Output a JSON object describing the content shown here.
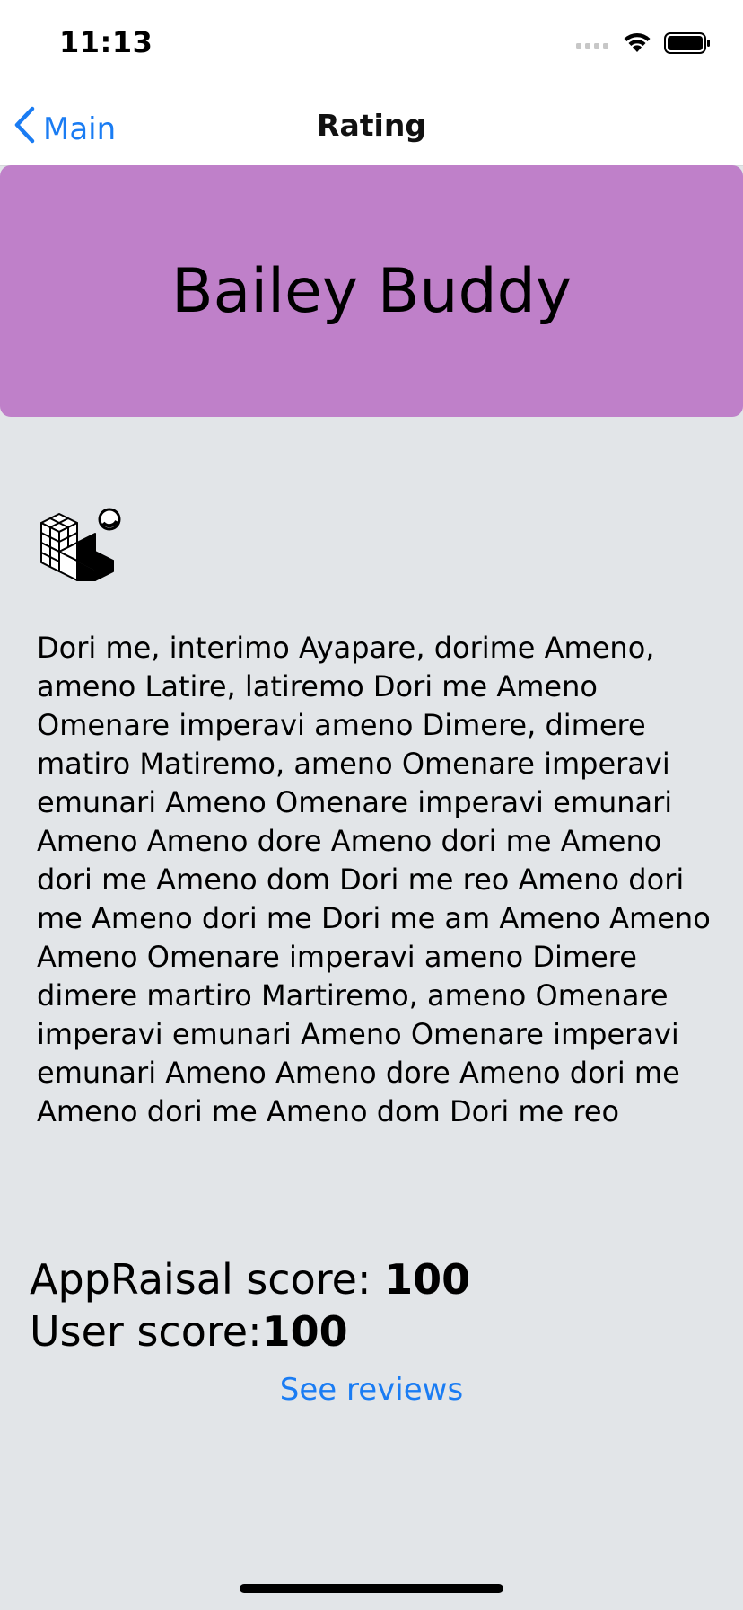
{
  "status_bar": {
    "time": "11:13"
  },
  "nav": {
    "back_label": "Main",
    "title": "Rating"
  },
  "hero": {
    "title": "Bailey Buddy",
    "color": "#bf80c9"
  },
  "content": {
    "icon": "cube-blocks-icon",
    "description": "Dori me, interimo Ayapare, dorime Ameno, ameno Latire, latiremo Dori me Ameno Omenare imperavi ameno Dimere, dimere matiro Matiremo, ameno Omenare imperavi emunari Ameno Omenare imperavi emunari Ameno Ameno dore Ameno dori me Ameno dori me Ameno dom Dori me reo Ameno dori me Ameno dori me Dori me am Ameno Ameno Ameno Omenare imperavi ameno Dimere dimere martiro Martiremo, ameno Omenare imperavi emunari Ameno Omenare imperavi emunari Ameno Ameno dore Ameno dori me Ameno dori me Ameno dom Dori me reo"
  },
  "scores": {
    "appraisal_label": "AppRaisal score: ",
    "appraisal_value": "100",
    "user_label": "User score:",
    "user_value": "100"
  },
  "actions": {
    "see_reviews_label": "See reviews"
  },
  "colors": {
    "accent": "#1a7cf3",
    "background": "#e2e5e8"
  }
}
